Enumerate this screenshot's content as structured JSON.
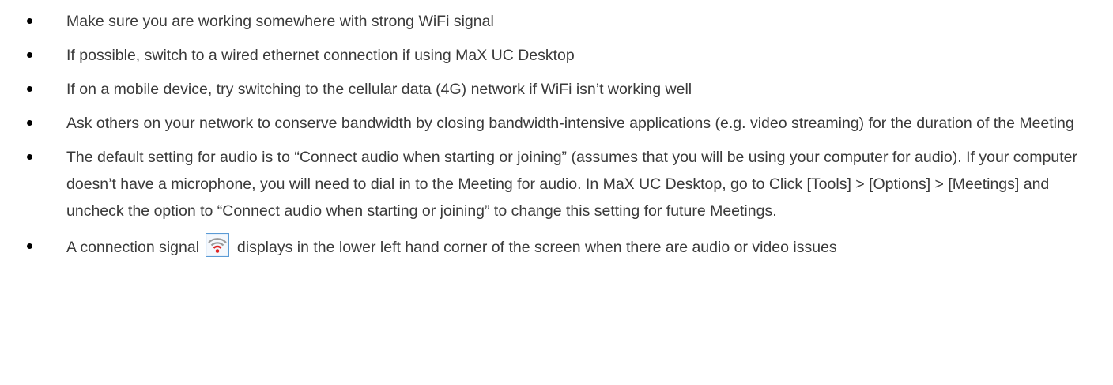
{
  "bullets": [
    {
      "text": "Make sure you are working somewhere with strong WiFi signal"
    },
    {
      "text": "If possible, switch to a wired ethernet connection if using MaX UC Desktop"
    },
    {
      "text": "If on a mobile device, try switching to the cellular data (4G) network if WiFi isn’t working well"
    },
    {
      "text": "Ask others on your network to conserve bandwidth by closing bandwidth-intensive applications (e.g. video streaming) for the duration of the Meeting"
    },
    {
      "text": "The default setting for audio is to “Connect audio when starting or joining” (assumes that you will be using your computer for audio). If your computer doesn’t have a microphone, you will need to dial in to the Meeting for audio. In MaX UC Desktop, go to Click [Tools] > [Options] > [Meetings] and uncheck the option to “Connect audio when starting or joining” to change this setting for future Meetings."
    },
    {
      "text_before": "A connection signal",
      "icon": "connection-signal-icon",
      "text_after": "displays in the lower left hand corner of the screen when there are audio or video issues"
    }
  ]
}
